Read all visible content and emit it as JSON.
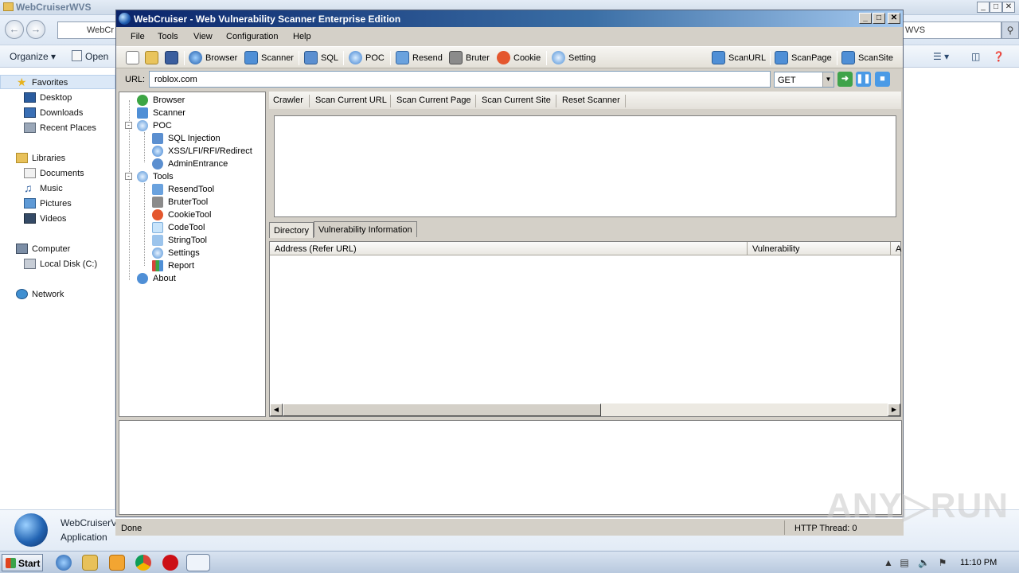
{
  "explorer": {
    "title": "WebCruiserWVS",
    "address_text": "WebCr",
    "search_text": "WVS",
    "commands": {
      "organize": "Organize",
      "open": "Open"
    },
    "nav": {
      "favorites": "Favorites",
      "desktop": "Desktop",
      "downloads": "Downloads",
      "recent": "Recent Places",
      "libraries": "Libraries",
      "documents": "Documents",
      "music": "Music",
      "pictures": "Pictures",
      "videos": "Videos",
      "computer": "Computer",
      "local_disk": "Local Disk (C:)",
      "network": "Network"
    },
    "details": {
      "name": "WebCruiserV",
      "type": "Application"
    }
  },
  "app": {
    "title": "WebCruiser - Web Vulnerability Scanner Enterprise Edition",
    "menu": [
      "File",
      "Tools",
      "View",
      "Configuration",
      "Help"
    ],
    "toolbar": {
      "browser": "Browser",
      "scanner": "Scanner",
      "sql": "SQL",
      "poc": "POC",
      "resend": "Resend",
      "bruter": "Bruter",
      "cookie": "Cookie",
      "setting": "Setting",
      "scan_url": "ScanURL",
      "scan_page": "ScanPage",
      "scan_site": "ScanSite"
    },
    "url_label": "URL:",
    "url_value": "roblox.com",
    "method": "GET",
    "tree": {
      "browser": "Browser",
      "scanner": "Scanner",
      "poc": "POC",
      "sql_injection": "SQL Injection",
      "xss": "XSS/LFI/RFI/Redirect",
      "admin": "AdminEntrance",
      "tools": "Tools",
      "resend": "ResendTool",
      "bruter": "BruterTool",
      "cookie": "CookieTool",
      "code": "CodeTool",
      "string": "StringTool",
      "settings": "Settings",
      "report": "Report",
      "about": "About"
    },
    "scan_toolbar": [
      "Crawler",
      "Scan Current URL",
      "Scan Current Page",
      "Scan Current Site",
      "Reset Scanner"
    ],
    "tabs": {
      "directory": "Directory",
      "vuln_info": "Vulnerability Information"
    },
    "columns": {
      "address": "Address (Refer URL)",
      "vulnerability": "Vulnerability",
      "extra": "A"
    },
    "status": {
      "text": "Done",
      "thread": "HTTP Thread: 0"
    }
  },
  "watermark": "ANY▷RUN",
  "taskbar": {
    "start": "Start",
    "time": "11:10 PM"
  },
  "colors": {
    "title_gradient_start": "#0a246a",
    "title_gradient_end": "#a6caf0",
    "window_bg": "#d4d0c8"
  }
}
